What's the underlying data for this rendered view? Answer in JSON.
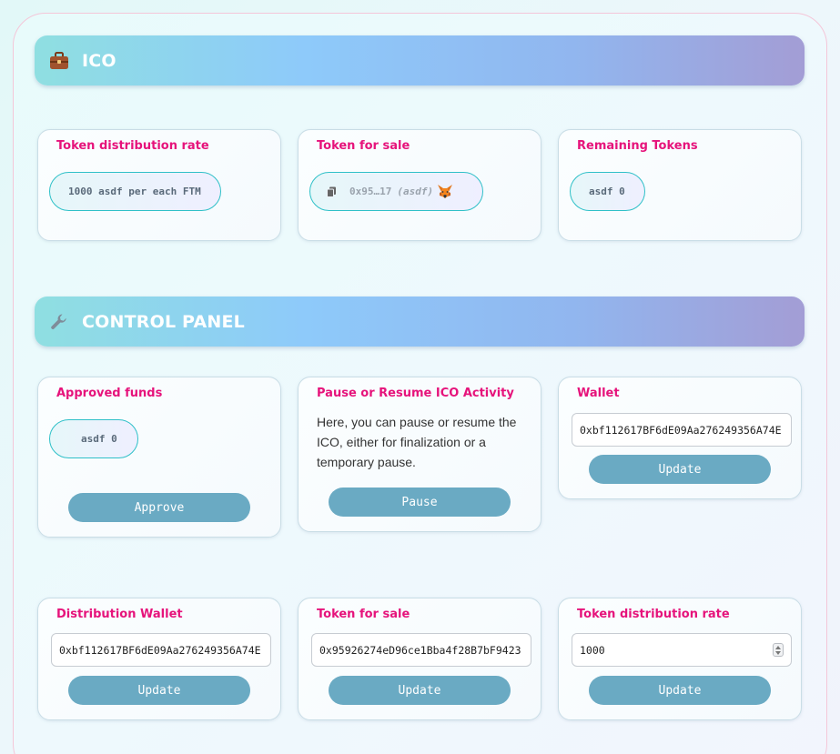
{
  "ico_section": {
    "title": "ICO",
    "icon": "briefcase-icon",
    "cards": {
      "distribution_rate": {
        "title": "Token distribution rate",
        "value": "1000 asdf per each FTM"
      },
      "token_for_sale": {
        "title": "Token for sale",
        "address": "0x95…17",
        "symbol": "(asdf)",
        "copy_icon": "copy-icon",
        "wallet_icon": "metamask-fox-icon"
      },
      "remaining_tokens": {
        "title": "Remaining Tokens",
        "value": "asdf 0"
      }
    }
  },
  "control_panel": {
    "title": "CONTROL PANEL",
    "icon": "wrench-icon",
    "approved_funds": {
      "title": "Approved funds",
      "value": "asdf 0",
      "button_label": "Approve"
    },
    "pause_resume": {
      "title": "Pause or Resume ICO Activity",
      "description": "Here, you can pause or resume the ICO, either for finalization or a temporary pause.",
      "button_label": "Pause"
    },
    "wallet": {
      "title": "Wallet",
      "input_value": "0xbf112617BF6dE09Aa276249356A74E",
      "button_label": "Update"
    },
    "distribution_wallet": {
      "title": "Distribution Wallet",
      "input_value": "0xbf112617BF6dE09Aa276249356A74E",
      "button_label": "Update"
    },
    "token_for_sale": {
      "title": "Token for sale",
      "input_value": "0x95926274eD96ce1Bba4f28B7bF9423",
      "button_label": "Update"
    },
    "distribution_rate": {
      "title": "Token distribution rate",
      "input_value": "1000",
      "button_label": "Update"
    }
  },
  "colors": {
    "accent_pink": "#e6137b",
    "button_blue": "#6aaac3",
    "pill_border": "#2fc0c8"
  }
}
